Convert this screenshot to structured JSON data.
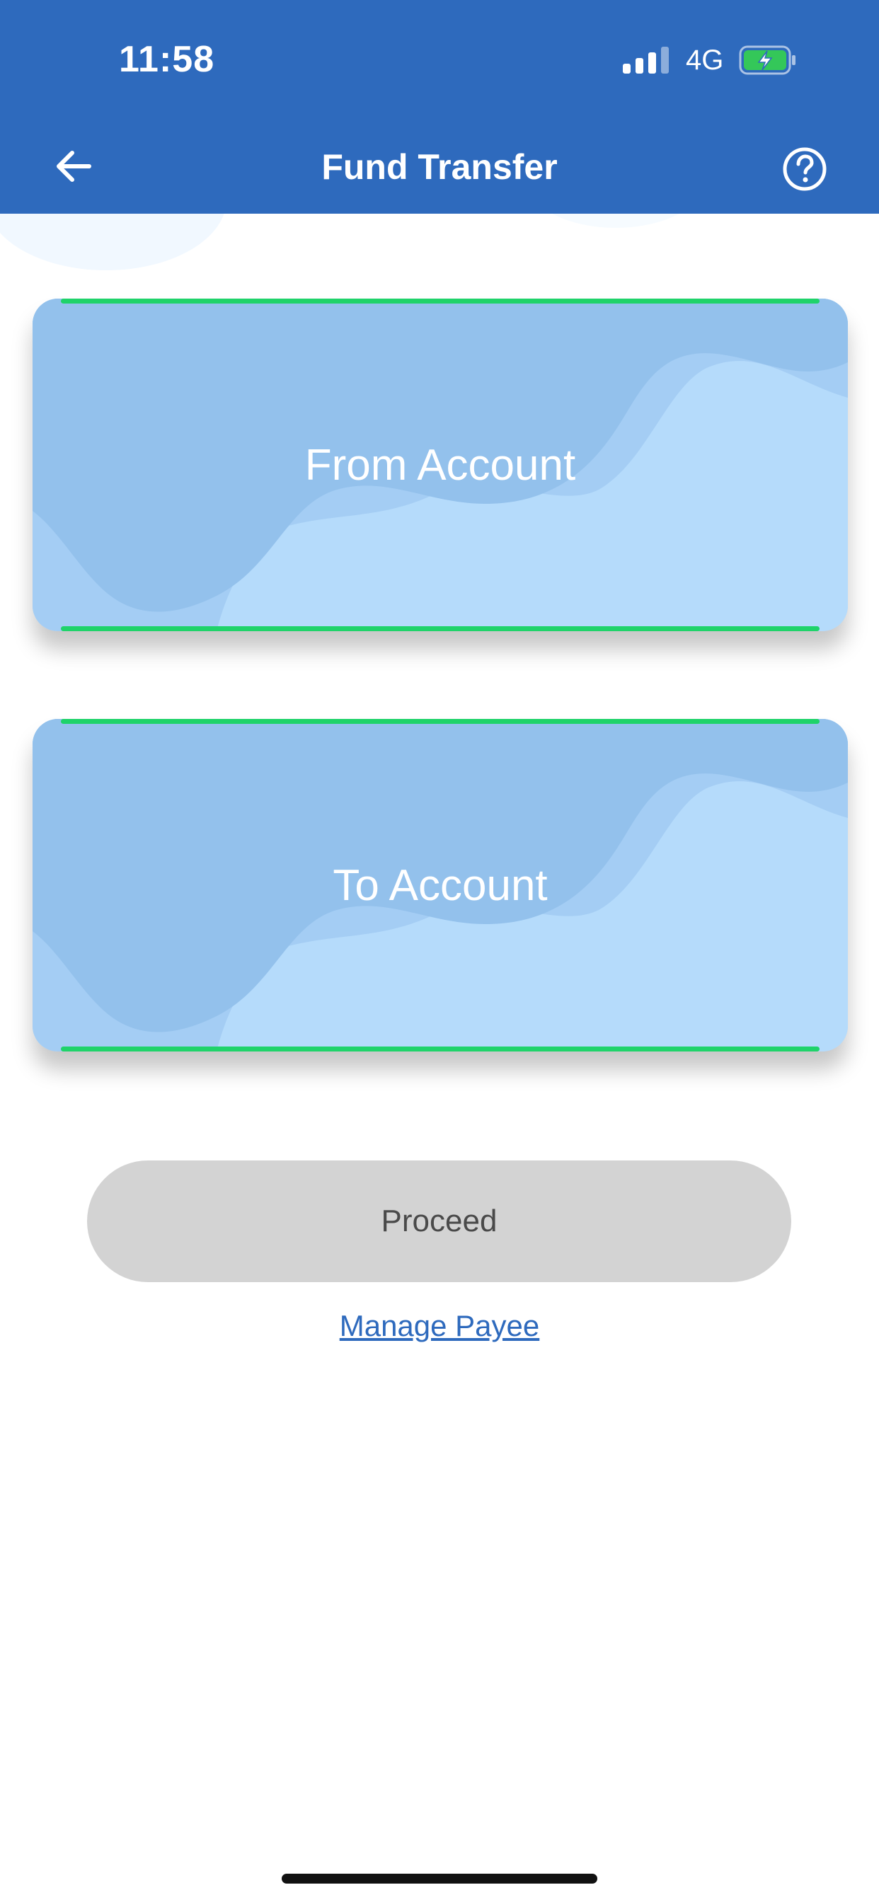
{
  "status_bar": {
    "time": "11:58",
    "network": "4G",
    "battery_icon": "battery-charging-icon",
    "signal_icon": "signal-icon"
  },
  "header": {
    "title": "Fund Transfer",
    "back_icon": "arrow-left-icon",
    "help_icon": "question-circle-icon"
  },
  "cards": {
    "from_label": "From Account",
    "to_label": "To Account"
  },
  "actions": {
    "proceed_label": "Proceed",
    "manage_payee_label": "Manage Payee"
  },
  "colors": {
    "header": "#2e6abd",
    "card_light": "#b5dbfb",
    "card_wave": "#93c1ec",
    "card_edge": "#1fd36a",
    "button_disabled": "#d3d3d3",
    "link": "#2e6abd"
  }
}
